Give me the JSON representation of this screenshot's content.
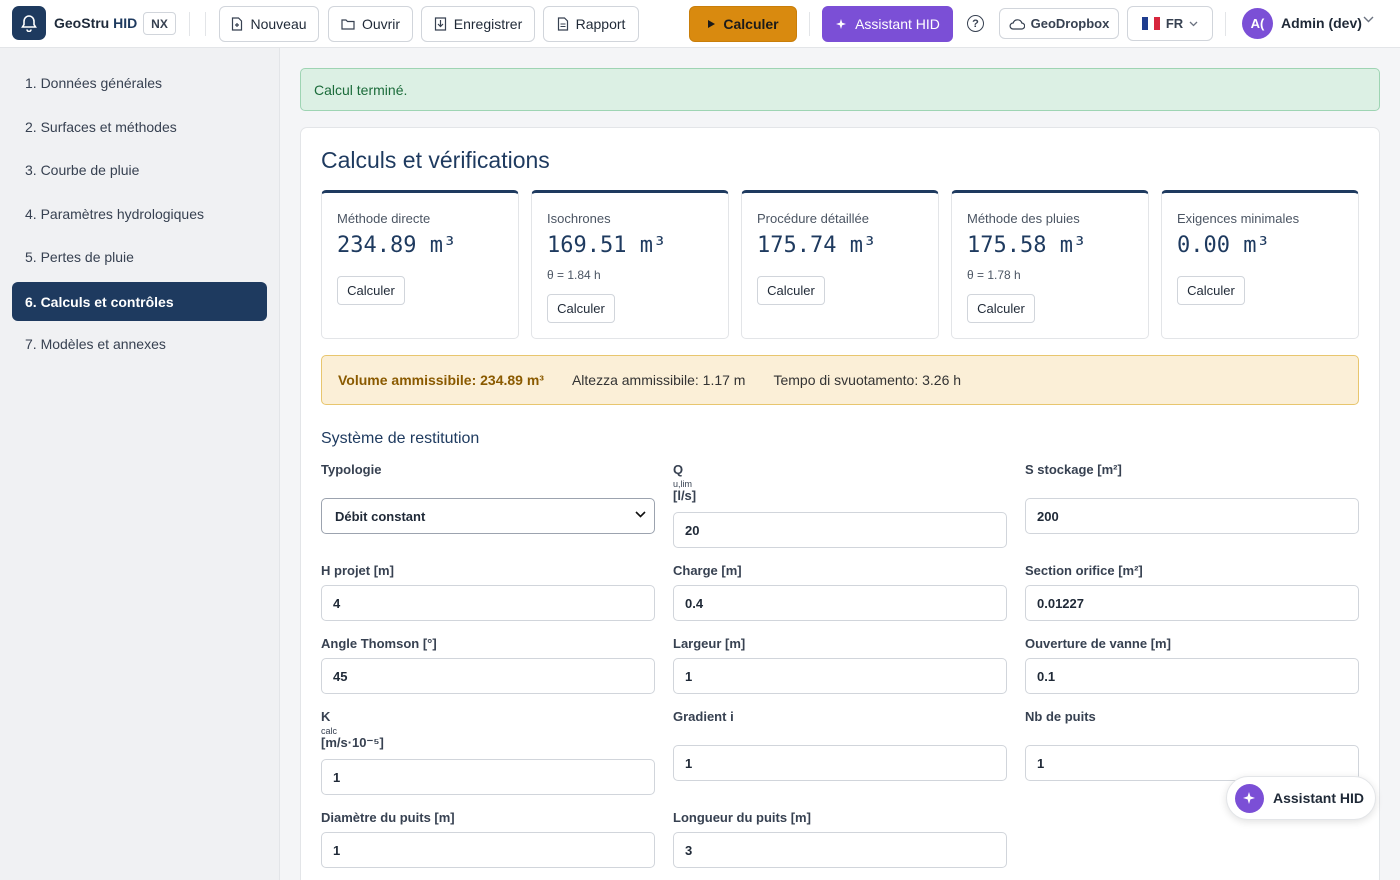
{
  "app": {
    "name_part1": "GeoStru",
    "name_part2": "HID",
    "badge": "NX"
  },
  "toolbar": {
    "new": "Nouveau",
    "open": "Ouvrir",
    "save": "Enregistrer",
    "report": "Rapport",
    "calculate": "Calculer",
    "assistant": "Assistant HID",
    "help": "?",
    "dropbox": "GeoDropbox",
    "language": "FR",
    "avatar_initials": "A(",
    "user": "Admin (dev)"
  },
  "sidebar": {
    "items": [
      {
        "label": "1. Données générales"
      },
      {
        "label": "2. Surfaces et méthodes"
      },
      {
        "label": "3. Courbe de pluie"
      },
      {
        "label": "4. Paramètres hydrologiques"
      },
      {
        "label": "5. Pertes de pluie"
      },
      {
        "label": "6. Calculs et contrôles"
      },
      {
        "label": "7. Modèles et annexes"
      }
    ]
  },
  "alert": {
    "message": "Calcul terminé."
  },
  "main": {
    "title": "Calculs et vérifications",
    "methods": [
      {
        "label": "Méthode directe",
        "value": "234.89 m³",
        "sub": "",
        "button": "Calculer"
      },
      {
        "label": "Isochrones",
        "value": "169.51 m³",
        "sub": "θ = 1.84 h",
        "button": "Calculer"
      },
      {
        "label": "Procédure détaillée",
        "value": "175.74 m³",
        "sub": "",
        "button": "Calculer"
      },
      {
        "label": "Méthode des pluies",
        "value": "175.58 m³",
        "sub": "θ = 1.78 h",
        "button": "Calculer"
      },
      {
        "label": "Exigences minimales",
        "value": "0.00 m³",
        "sub": "",
        "button": "Calculer"
      }
    ],
    "summary": {
      "volume": "Volume ammissibile: 234.89 m³",
      "height": "Altezza ammissibile: 1.17 m",
      "time": "Tempo di svuotamento: 3.26 h"
    },
    "section_title": "Système de restitution",
    "fields": {
      "typologie": {
        "label": "Typologie",
        "value": "Débit constant"
      },
      "q": {
        "label": "Q",
        "sub": "u,lim",
        "unit": "[l/s]",
        "value": "20"
      },
      "s_stockage": {
        "label": "S stockage [m²]",
        "value": "200"
      },
      "h_projet": {
        "label": "H projet [m]",
        "value": "4"
      },
      "charge": {
        "label": "Charge [m]",
        "value": "0.4"
      },
      "section_orifice": {
        "label": "Section orifice [m²]",
        "value": "0.01227"
      },
      "angle_thomson": {
        "label": "Angle Thomson [°]",
        "value": "45"
      },
      "largeur": {
        "label": "Largeur [m]",
        "value": "1"
      },
      "ouverture_vanne": {
        "label": "Ouverture de vanne [m]",
        "value": "0.1"
      },
      "k": {
        "label": "K",
        "sub": "calc",
        "unit": "[m/s·10⁻⁵]",
        "value": "1"
      },
      "gradient": {
        "label": "Gradient i",
        "value": "1"
      },
      "nb_puits": {
        "label": "Nb de puits",
        "value": "1"
      },
      "diametre_puits": {
        "label": "Diamètre du puits [m]",
        "value": "1"
      },
      "longueur_puits": {
        "label": "Longueur du puits [m]",
        "value": "3"
      }
    }
  },
  "floating_assistant": {
    "label": "Assistant HID"
  },
  "colors": {
    "primary": "#1e3a5f",
    "calculate": "#d98a0f",
    "assistant": "#7b4fd6",
    "success_bg": "#dcf0e4",
    "warning_bg": "#fbefd7"
  }
}
